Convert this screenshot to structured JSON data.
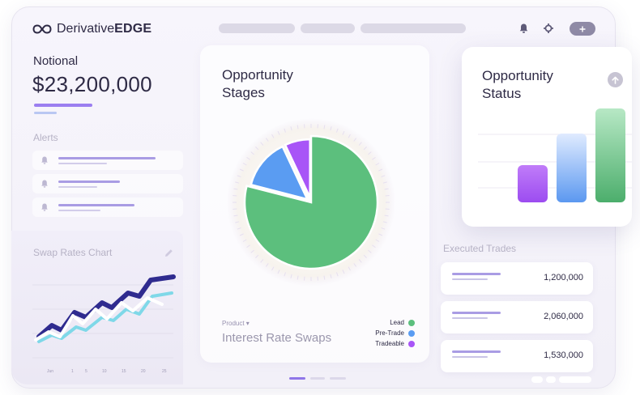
{
  "brand": {
    "prefix": "Derivative",
    "suffix": "EDGE",
    "mark": "infinity-logo"
  },
  "notional": {
    "label": "Notional",
    "value": "$23,200,000"
  },
  "alerts": {
    "label": "Alerts",
    "count": 3
  },
  "swap_chart": {
    "title": "Swap Rates Chart",
    "x_ticks": [
      "Jun",
      "1",
      "5",
      "10",
      "15",
      "20",
      "25"
    ]
  },
  "stages": {
    "title_line1": "Opportunity",
    "title_line2": "Stages",
    "product_label": "Product ▾",
    "product_value": "Interest Rate Swaps",
    "legend": [
      {
        "label": "Lead",
        "color": "#5cbf7d"
      },
      {
        "label": "Pre-Trade",
        "color": "#5a9cf2"
      },
      {
        "label": "Tradeable",
        "color": "#a855f7"
      }
    ]
  },
  "status": {
    "title_line1": "Opportunity",
    "title_line2": "Status",
    "bars": [
      {
        "color": "#a855f7"
      },
      {
        "color": "#6aa7f3"
      },
      {
        "color": "#5cc07f"
      }
    ]
  },
  "trades": {
    "label": "Executed Trades",
    "rows": [
      {
        "value": "1,200,000"
      },
      {
        "value": "2,060,000"
      },
      {
        "value": "1,530,000"
      }
    ]
  },
  "chart_data": [
    {
      "type": "pie",
      "categories": [
        "Lead",
        "Pre-Trade",
        "Tradeable"
      ],
      "values": [
        79,
        14,
        7
      ]
    }
  ],
  "colors": {
    "accent": "#9b7ef0",
    "text": "#2e2a45",
    "muted": "#b6b2c5"
  }
}
